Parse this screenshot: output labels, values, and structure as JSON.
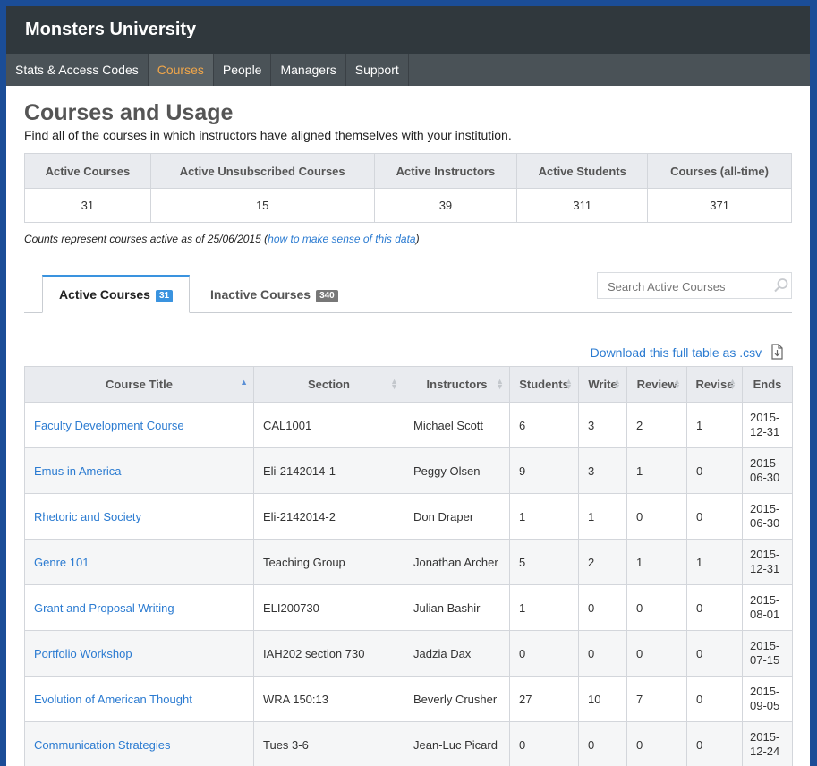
{
  "app": {
    "title": "Monsters University"
  },
  "nav": [
    {
      "label": "Stats & Access Codes",
      "active": false
    },
    {
      "label": "Courses",
      "active": true
    },
    {
      "label": "People",
      "active": false
    },
    {
      "label": "Managers",
      "active": false
    },
    {
      "label": "Support",
      "active": false
    }
  ],
  "page": {
    "title": "Courses and Usage",
    "subtitle": "Find all of the courses in which instructors have aligned themselves with your institution."
  },
  "stats": {
    "headers": [
      "Active Courses",
      "Active Unsubscribed Courses",
      "Active Instructors",
      "Active Students",
      "Courses (all-time)"
    ],
    "values": [
      "31",
      "15",
      "39",
      "311",
      "371"
    ]
  },
  "note": {
    "text": "Counts represent courses active as of 25/06/2015 (",
    "link": "how to make sense of this data",
    "end": ")"
  },
  "tabs": {
    "active_label": "Active Courses",
    "active_count": "31",
    "inactive_label": "Inactive Courses",
    "inactive_count": "340"
  },
  "search": {
    "placeholder": "Search Active Courses"
  },
  "download": {
    "label": "Download this full table as .csv"
  },
  "courses": {
    "headers": [
      "Course Title",
      "Section",
      "Instructors",
      "Students",
      "Write",
      "Review",
      "Revise",
      "Ends"
    ],
    "rows": [
      [
        "Faculty Development Course",
        "CAL1001",
        "Michael Scott",
        "6",
        "3",
        "2",
        "1",
        "2015-\n12-31"
      ],
      [
        "Emus in America",
        "Eli-2142014-1",
        "Peggy Olsen",
        "9",
        "3",
        "1",
        "0",
        "2015-\n06-30"
      ],
      [
        "Rhetoric and Society",
        "Eli-2142014-2",
        "Don Draper",
        "1",
        "1",
        "0",
        "0",
        "2015-\n06-30"
      ],
      [
        "Genre 101",
        "Teaching Group",
        "Jonathan Archer",
        "5",
        "2",
        "1",
        "1",
        "2015-\n12-31"
      ],
      [
        "Grant and Proposal Writing",
        "ELI200730",
        "Julian Bashir",
        "1",
        "0",
        "0",
        "0",
        "2015-\n08-01"
      ],
      [
        "Portfolio Workshop",
        "IAH202 section 730",
        "Jadzia Dax",
        "0",
        "0",
        "0",
        "0",
        "2015-\n07-15"
      ],
      [
        "Evolution of American Thought",
        "WRA 150:13",
        "Beverly Crusher",
        "27",
        "10",
        "7",
        "0",
        "2015-\n09-05"
      ],
      [
        "Communication Strategies",
        "Tues 3-6",
        "Jean-Luc Picard",
        "0",
        "0",
        "0",
        "0",
        "2015-\n12-24"
      ]
    ]
  },
  "colors": {
    "accent": "#f0a64a",
    "link": "#2b7bd1",
    "header_bg": "#30383d",
    "nav_bg": "#4a5257",
    "tab_accent": "#3a93df"
  }
}
